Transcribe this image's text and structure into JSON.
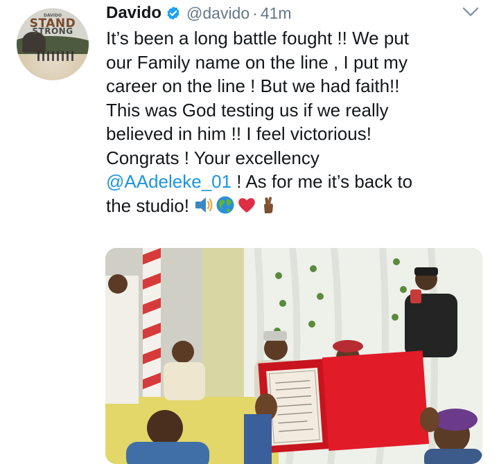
{
  "avatar": {
    "brand_small": "DAVIDO",
    "line1": "STAND",
    "line2": "STRONG"
  },
  "tweet": {
    "name": "Davido",
    "handle": "@davido",
    "separator": "·",
    "time": "41m",
    "lines": [
      "It’s been a long battle fought !! We put",
      "our Family name on the line , I put my",
      "career on the line ! But we had faith!!",
      "This was God testing us if we really",
      "believed in him !! I feel victorious!",
      "Congrats ! Your excellency"
    ],
    "mention": "@AAdeleke_01",
    "after_mention": " ! As for me it’s back to",
    "last_line": "the studio! "
  },
  "icons": {
    "verified": "verified-badge-icon",
    "caret": "chevron-down-icon",
    "emojis": [
      "speaker-emoji-icon",
      "globe-emoji-icon",
      "red-heart-emoji-icon",
      "crossed-fingers-emoji-icon"
    ]
  },
  "media": {
    "description_icon": "photo"
  },
  "colors": {
    "link": "#1b95e0",
    "secondary": "#657786",
    "verified": "#1da1f2"
  }
}
